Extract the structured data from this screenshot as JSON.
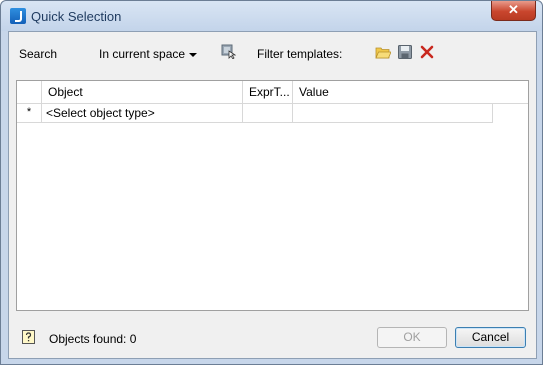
{
  "window": {
    "title": "Quick Selection",
    "close_glyph": "✕"
  },
  "toolbar": {
    "search_label": "Search",
    "scope_value": "In current space",
    "filter_label": "Filter templates:",
    "icons": [
      "select-objects-icon",
      "open-folder-icon",
      "save-icon",
      "delete-icon"
    ]
  },
  "grid": {
    "columns": [
      "Object",
      "ExprT...",
      "Value"
    ],
    "rows": [
      {
        "marker": "*",
        "object": "<Select object type>",
        "expr": "",
        "value": ""
      }
    ]
  },
  "status": {
    "text": "Objects found: 0"
  },
  "buttons": {
    "ok": "OK",
    "cancel": "Cancel"
  },
  "colors": {
    "close_button": "#c9462e",
    "delete_x": "#c8281e",
    "folder": "#e8b93a"
  }
}
